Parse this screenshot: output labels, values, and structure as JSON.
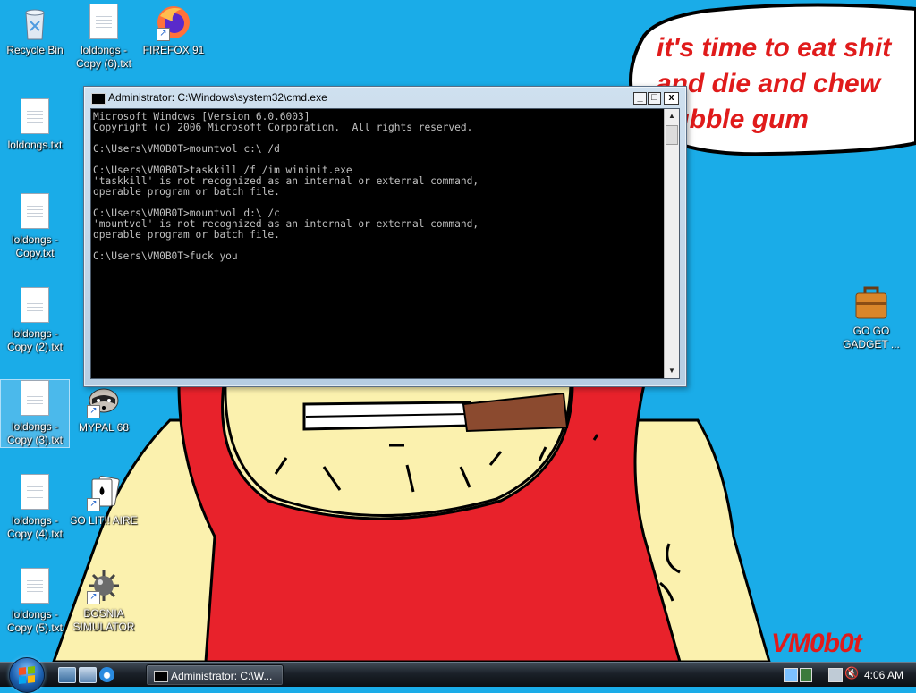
{
  "wallpaper": {
    "speech_bubble_lines": [
      "it's time to eat shit",
      "and die and chew",
      "bubble gum"
    ],
    "signature": "VM0b0t"
  },
  "desktop": {
    "icons": [
      {
        "label": "Recycle Bin",
        "icon": "recycle-bin-icon"
      },
      {
        "label": "loldongs - Copy (6).txt",
        "icon": "text-file-icon"
      },
      {
        "label": "FIREFOX 91",
        "icon": "firefox-icon"
      },
      {
        "label": "loldongs.txt",
        "icon": "text-file-icon"
      },
      {
        "label": "loldongs - Copy.txt",
        "icon": "text-file-icon"
      },
      {
        "label": "loldongs - Copy (2).txt",
        "icon": "text-file-icon"
      },
      {
        "label": "loldongs - Copy (3).txt",
        "icon": "text-file-icon"
      },
      {
        "label": "MYPAL 68",
        "icon": "mypal-raccoon-icon"
      },
      {
        "label": "loldongs - Copy (4).txt",
        "icon": "text-file-icon"
      },
      {
        "label": "SO LIT!! AIRE",
        "icon": "solitaire-cards-icon"
      },
      {
        "label": "loldongs - Copy (5).txt",
        "icon": "text-file-icon"
      },
      {
        "label": "BOSNIA SIMULATOR",
        "icon": "minesweeper-mine-icon"
      },
      {
        "label": "GO GO GADGET ...",
        "icon": "briefcase-icon"
      }
    ]
  },
  "cmd_window": {
    "title": "Administrator: C:\\Windows\\system32\\cmd.exe",
    "controls": {
      "minimize": "_",
      "maximize": "□",
      "close": "x"
    },
    "console_text": "Microsoft Windows [Version 6.0.6003]\nCopyright (c) 2006 Microsoft Corporation.  All rights reserved.\n\nC:\\Users\\VM0B0T>mountvol c:\\ /d\n\nC:\\Users\\VM0B0T>taskkill /f /im wininit.exe\n'taskkill' is not recognized as an internal or external command,\noperable program or batch file.\n\nC:\\Users\\VM0B0T>mountvol d:\\ /c\n'mountvol' is not recognized as an internal or external command,\noperable program or batch file.\n\nC:\\Users\\VM0B0T>fuck you"
  },
  "taskbar": {
    "quick_launch": [
      "show-desktop-icon",
      "switch-windows-icon",
      "internet-explorer-icon"
    ],
    "task_button_label": "Administrator: C:\\W...",
    "tray_icons": [
      "network-icon",
      "network-warning-icon",
      "volume-muted-icon"
    ],
    "clock": "4:06 AM"
  }
}
